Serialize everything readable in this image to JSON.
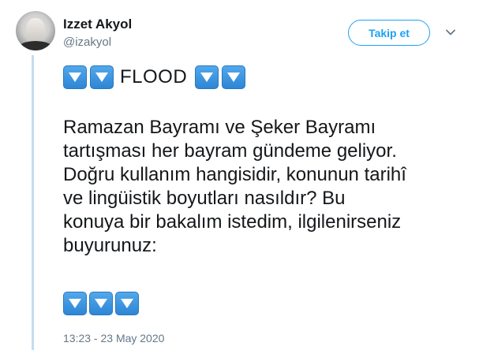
{
  "author": {
    "display_name": "Izzet Akyol",
    "handle": "@izakyol"
  },
  "follow_button": {
    "label": "Takip et"
  },
  "tweet": {
    "flood_word": "FLOOD",
    "body": "Ramazan Bayramı ve Şeker Bayramı\ntartışması her bayram gündeme geliyor.\nDoğru kullanım hangisidir, konunun tarihî\nve lingüistik boyutları nasıldır? Bu\nkonuya bir bakalım istedim, ilgilenirseniz\nbuyurunuz:",
    "timestamp": "13:23 - 23 May 2020"
  },
  "icons": {
    "down_button": "down-arrow-button-icon",
    "caret": "chevron-down-icon"
  },
  "colors": {
    "accent": "#1da1f2",
    "secondary_text": "#657786",
    "thread_line": "#c4dcf0",
    "emoji_blue": "#3b93dd"
  }
}
